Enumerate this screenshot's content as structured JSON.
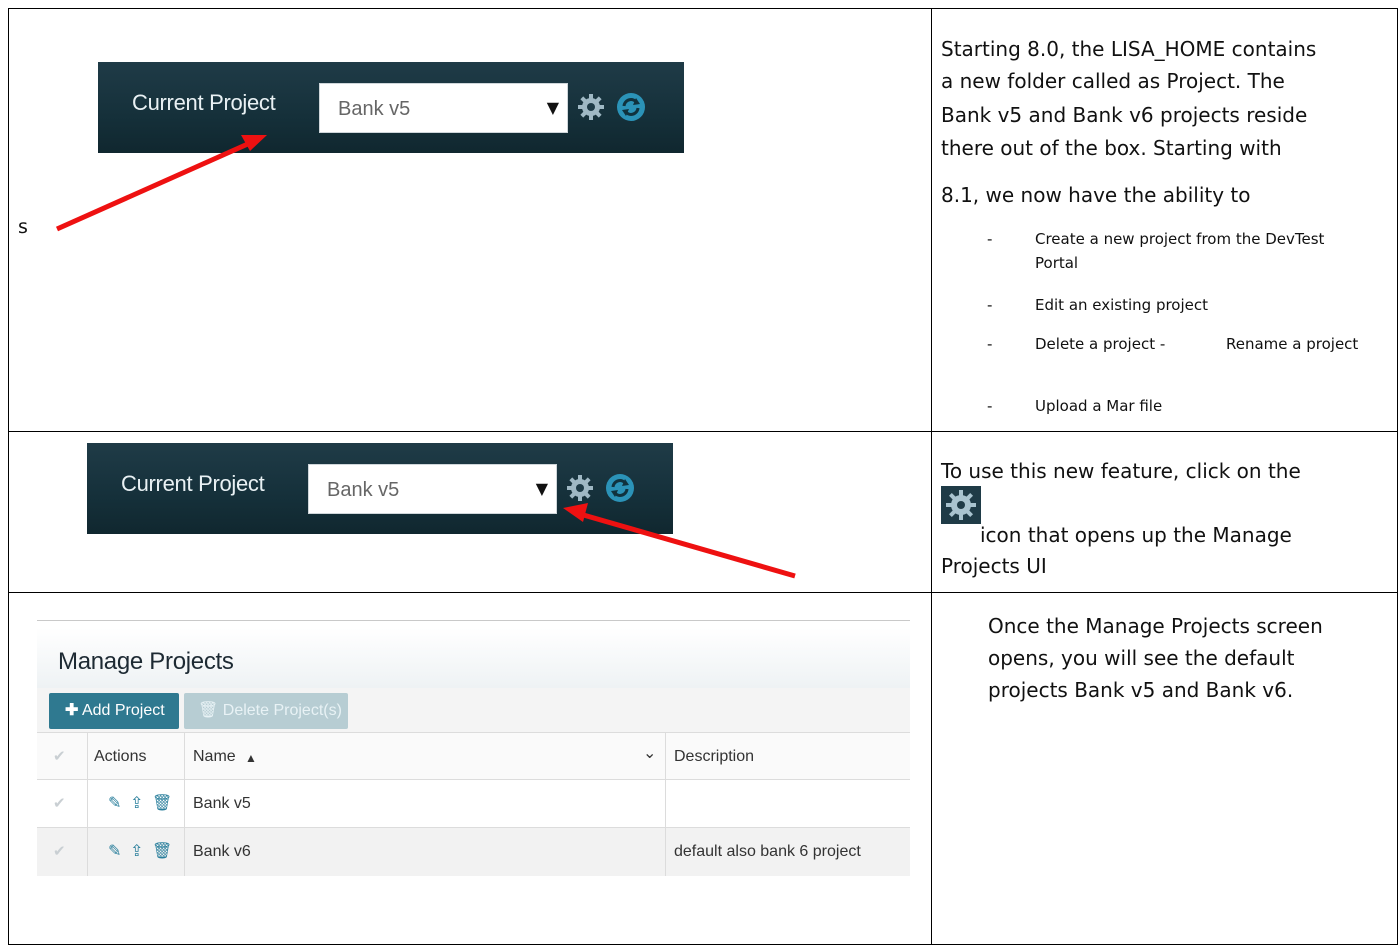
{
  "row1": {
    "banner": {
      "label": "Current Project",
      "selected_project": "Bank v5",
      "caret": "▼",
      "icons": [
        "gear-icon",
        "refresh-icon"
      ]
    },
    "stray_text": "s",
    "description_lines": [
      "Starting 8.0, the LISA_HOME contains",
      "a new folder called as Project. The",
      "Bank v5 and Bank v6 projects reside",
      "there out of the box. Starting with",
      "8.1, we now have the ability to"
    ],
    "list_dash": "-",
    "list": [
      {
        "line1": "Create a new project from the DevTest",
        "line2": "Portal"
      },
      {
        "line1": "Edit an existing project",
        "line2": ""
      },
      {
        "line1": "Delete a project -",
        "extra": "Rename a project",
        "line2": ""
      },
      {
        "line1": "Upload a Mar file",
        "line2": ""
      }
    ]
  },
  "row2": {
    "banner": {
      "label": "Current Project",
      "selected_project": "Bank v5",
      "caret": "▼",
      "icons": [
        "gear-icon",
        "refresh-icon"
      ]
    },
    "text_before_icon": "To use this new feature, click on the",
    "text_after_icon_1": " icon that opens up the Manage",
    "text_after_icon_2": "Projects UI"
  },
  "row3": {
    "manage_projects": {
      "title": "Manage Projects",
      "add_button": "Add Project",
      "delete_button": "Delete Project(s)",
      "columns": [
        "Actions",
        "Name",
        "Description"
      ],
      "sort_indicator": "▲",
      "column_menu": "⌄",
      "rows": [
        {
          "name": "Bank v5",
          "description": ""
        },
        {
          "name": "Bank v6",
          "description": "default also bank 6 project"
        }
      ],
      "row_actions": [
        "edit-icon",
        "upload-icon",
        "trash-icon"
      ]
    },
    "description_lines": [
      "Once the Manage Projects screen",
      "opens, you will see the default",
      "projects Bank v5 and Bank v6."
    ]
  },
  "colors": {
    "banner_bg": "#15303a",
    "accent_teal": "#2f7990",
    "arrow_red": "#ee1111"
  }
}
